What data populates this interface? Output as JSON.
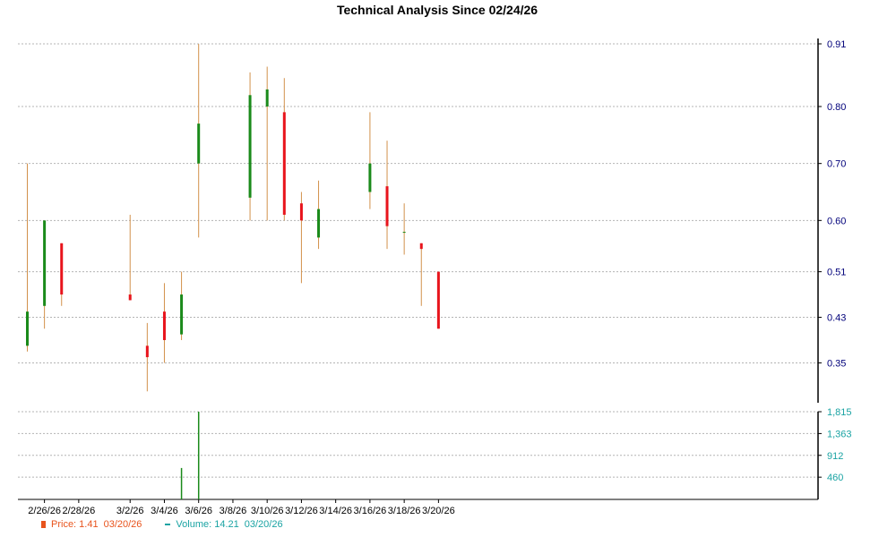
{
  "chart_data": {
    "type": "candlestick",
    "title": "Technical Analysis Since 02/24/26",
    "x_tick_labels": [
      "2/26/26",
      "2/28/26",
      "3/2/26",
      "3/4/26",
      "3/6/26",
      "3/8/26",
      "3/10/26",
      "3/12/26",
      "3/14/26",
      "3/16/26",
      "3/18/26",
      "3/20/26"
    ],
    "price_ticks": [
      "0.91",
      "0.80",
      "0.70",
      "0.60",
      "0.51",
      "0.43",
      "0.35"
    ],
    "volume_ticks": [
      "1,815",
      "1,363",
      "912",
      "460"
    ],
    "ylim_price": [
      0.28,
      0.91
    ],
    "ylim_volume": [
      0,
      1815
    ],
    "colors": {
      "up": "#1a8a1a",
      "down": "#e8141c",
      "wick": "#d2914b",
      "volume_text": "#1aa3a3",
      "price_text": "#00007a"
    },
    "candles": [
      {
        "date": "2/25/26",
        "open": 0.38,
        "high": 0.7,
        "low": 0.37,
        "close": 0.44,
        "volume": 0
      },
      {
        "date": "2/26/26",
        "open": 0.45,
        "high": 0.6,
        "low": 0.41,
        "close": 0.6,
        "volume": 0
      },
      {
        "date": "2/27/26",
        "open": 0.56,
        "high": 0.56,
        "low": 0.45,
        "close": 0.47,
        "volume": 0
      },
      {
        "date": "3/2/26",
        "open": 0.47,
        "high": 0.61,
        "low": 0.46,
        "close": 0.46,
        "volume": 0
      },
      {
        "date": "3/3/26",
        "open": 0.38,
        "high": 0.42,
        "low": 0.3,
        "close": 0.36,
        "volume": 0
      },
      {
        "date": "3/4/26",
        "open": 0.44,
        "high": 0.49,
        "low": 0.35,
        "close": 0.39,
        "volume": 0
      },
      {
        "date": "3/5/26",
        "open": 0.4,
        "high": 0.51,
        "low": 0.39,
        "close": 0.47,
        "volume": 650
      },
      {
        "date": "3/6/26",
        "open": 0.7,
        "high": 0.91,
        "low": 0.57,
        "close": 0.77,
        "volume": 1815
      },
      {
        "date": "3/9/26",
        "open": 0.64,
        "high": 0.86,
        "low": 0.6,
        "close": 0.82,
        "volume": 0
      },
      {
        "date": "3/10/26",
        "open": 0.8,
        "high": 0.87,
        "low": 0.6,
        "close": 0.83,
        "volume": 0
      },
      {
        "date": "3/11/26",
        "open": 0.79,
        "high": 0.85,
        "low": 0.6,
        "close": 0.61,
        "volume": 0
      },
      {
        "date": "3/12/26",
        "open": 0.63,
        "high": 0.65,
        "low": 0.49,
        "close": 0.6,
        "volume": 0
      },
      {
        "date": "3/13/26",
        "open": 0.57,
        "high": 0.67,
        "low": 0.55,
        "close": 0.62,
        "volume": 0
      },
      {
        "date": "3/16/26",
        "open": 0.65,
        "high": 0.79,
        "low": 0.62,
        "close": 0.7,
        "volume": 0
      },
      {
        "date": "3/17/26",
        "open": 0.66,
        "high": 0.74,
        "low": 0.55,
        "close": 0.59,
        "volume": 0
      },
      {
        "date": "3/18/26",
        "open": 0.58,
        "high": 0.63,
        "low": 0.54,
        "close": 0.58,
        "volume": 0
      },
      {
        "date": "3/19/26",
        "open": 0.56,
        "high": 0.56,
        "low": 0.45,
        "close": 0.55,
        "volume": 0
      },
      {
        "date": "3/20/26",
        "open": 0.51,
        "high": 0.51,
        "low": 0.41,
        "close": 0.41,
        "volume": 0
      }
    ],
    "grid": true
  },
  "legend": {
    "price_label": "Price: 1.41",
    "price_date": "03/20/26",
    "volume_label": "Volume: 14.21",
    "volume_date": "03/20/26"
  }
}
